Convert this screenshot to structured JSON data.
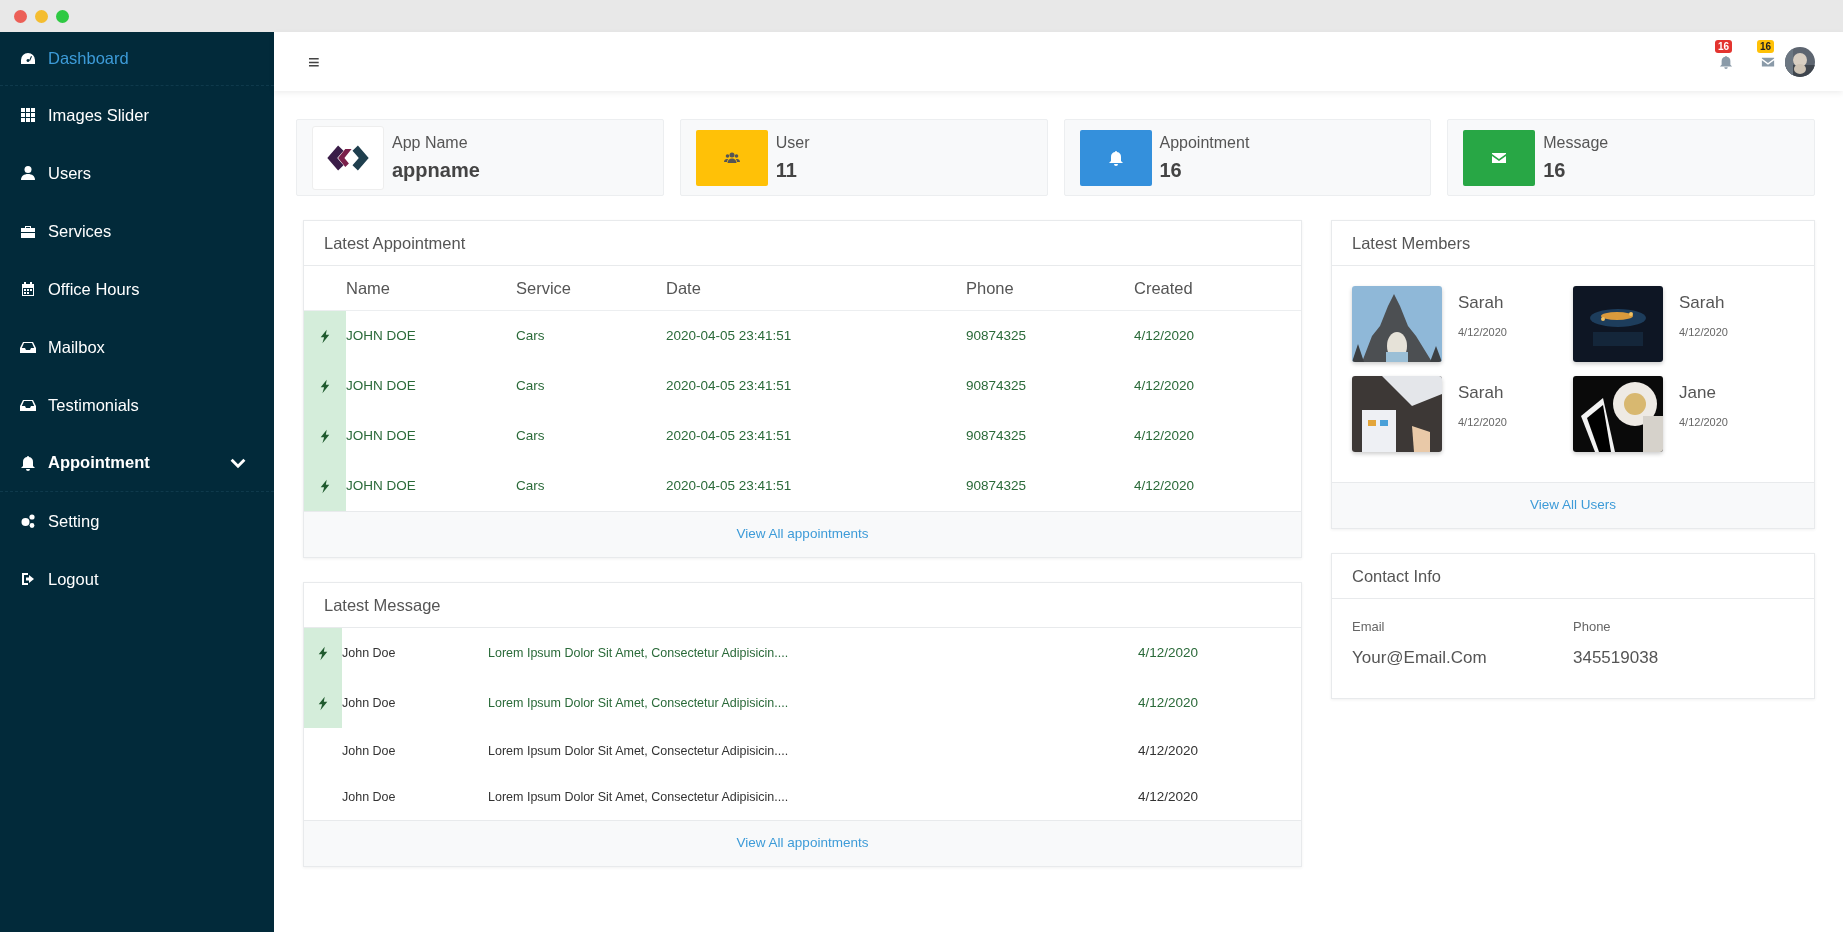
{
  "sidebar": {
    "items": [
      {
        "label": "Dashboard",
        "selected": true,
        "submenu": false
      },
      {
        "label": "Images Slider",
        "selected": false,
        "submenu": false
      },
      {
        "label": "Users",
        "selected": false,
        "submenu": false
      },
      {
        "label": "Services",
        "selected": false,
        "submenu": false
      },
      {
        "label": "Office Hours",
        "selected": false,
        "submenu": false
      },
      {
        "label": "Mailbox",
        "selected": false,
        "submenu": false
      },
      {
        "label": "Testimonials",
        "selected": false,
        "submenu": false
      },
      {
        "label": "Appointment",
        "selected": false,
        "submenu": true
      },
      {
        "label": "Setting",
        "selected": false,
        "submenu": false
      },
      {
        "label": "Logout",
        "selected": false,
        "submenu": false
      }
    ]
  },
  "topbar": {
    "menu_glyph": "≡",
    "notifications": [
      {
        "count": "16",
        "color": "#e3342f"
      },
      {
        "count": "16",
        "color": "#ffc107"
      }
    ]
  },
  "stats": [
    {
      "kind": "logo",
      "label": "App Name",
      "value": "appname"
    },
    {
      "kind": "icon",
      "label": "User",
      "value": "11",
      "color": "#ffc107"
    },
    {
      "kind": "icon",
      "label": "Appointment",
      "value": "16",
      "color": "#3490dc"
    },
    {
      "kind": "icon",
      "label": "Message",
      "value": "16",
      "color": "#28a745"
    }
  ],
  "appointments": {
    "title": "Latest Appointment",
    "columns": [
      "Name",
      "Service",
      "Date",
      "Phone",
      "Created"
    ],
    "rows": [
      {
        "highlighted": true,
        "cells": [
          "JOHN DOE",
          "Cars",
          "2020-04-05 23:41:51",
          "90874325",
          "4/12/2020"
        ]
      },
      {
        "highlighted": true,
        "cells": [
          "JOHN DOE",
          "Cars",
          "2020-04-05 23:41:51",
          "90874325",
          "4/12/2020"
        ]
      },
      {
        "highlighted": true,
        "cells": [
          "JOHN DOE",
          "Cars",
          "2020-04-05 23:41:51",
          "90874325",
          "4/12/2020"
        ]
      },
      {
        "highlighted": true,
        "cells": [
          "JOHN DOE",
          "Cars",
          "2020-04-05 23:41:51",
          "90874325",
          "4/12/2020"
        ]
      }
    ],
    "footer_link": "View All appointments"
  },
  "messages": {
    "title": "Latest Message",
    "rows": [
      {
        "highlighted": true,
        "name": "John Doe",
        "text": "Lorem Ipsum Dolor Sit Amet, Consectetur Adipisicin....",
        "date": "4/12/2020"
      },
      {
        "highlighted": true,
        "name": "John Doe",
        "text": "Lorem Ipsum Dolor Sit Amet, Consectetur Adipisicin....",
        "date": "4/12/2020"
      },
      {
        "highlighted": false,
        "name": "John Doe",
        "text": "Lorem Ipsum Dolor Sit Amet, Consectetur Adipisicin....",
        "date": "4/12/2020"
      },
      {
        "highlighted": false,
        "name": "John Doe",
        "text": "Lorem Ipsum Dolor Sit Amet, Consectetur Adipisicin....",
        "date": "4/12/2020"
      }
    ],
    "footer_link": "View All appointments"
  },
  "members": {
    "title": "Latest Members",
    "items": [
      {
        "name": "Sarah",
        "date": "4/12/2020"
      },
      {
        "name": "Sarah",
        "date": "4/12/2020"
      },
      {
        "name": "Sarah",
        "date": "4/12/2020"
      },
      {
        "name": "Jane",
        "date": "4/12/2020"
      }
    ],
    "footer_link": "View All Users"
  },
  "contact": {
    "title": "Contact Info",
    "fields": [
      {
        "label": "Email",
        "value": "Your@Email.Com"
      },
      {
        "label": "Phone",
        "value": "345519038"
      }
    ]
  }
}
